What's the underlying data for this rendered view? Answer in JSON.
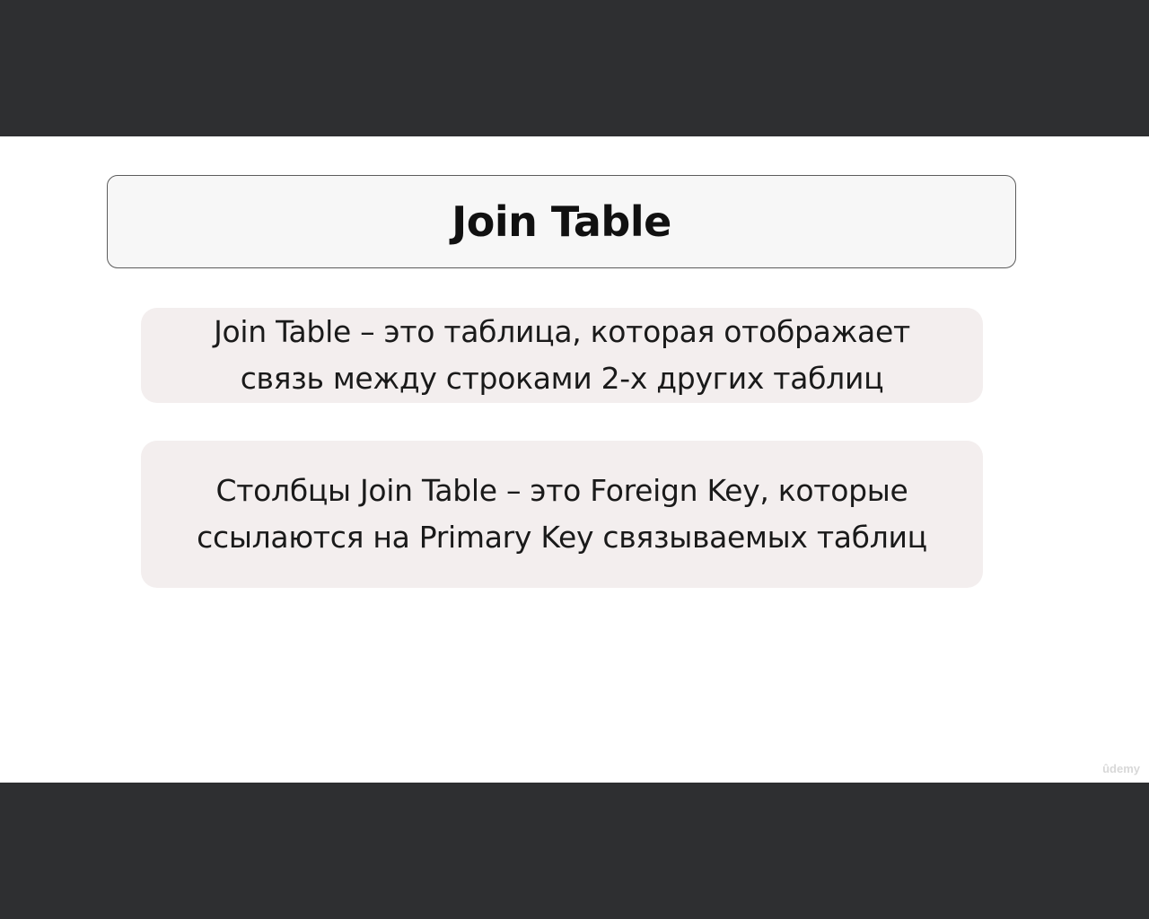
{
  "slide": {
    "title": "Join Table",
    "blocks": [
      {
        "lines": [
          "Join Table – это таблица, которая отображает",
          "связь между строками 2-х других таблиц"
        ]
      },
      {
        "lines": [
          "Столбцы Join Table – это Foreign Key, которые",
          "ссылаются на Primary Key связываемых таблиц"
        ]
      }
    ],
    "watermark": "ûdemy"
  }
}
